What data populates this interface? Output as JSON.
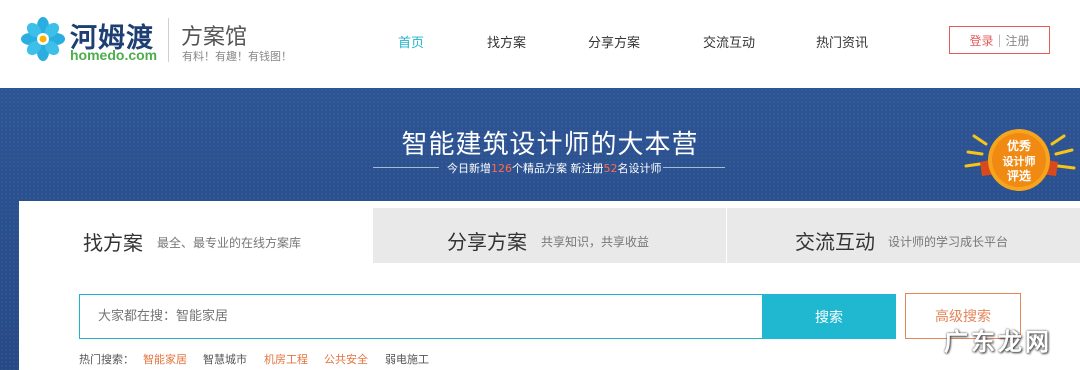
{
  "brand": {
    "name_cn": "河姆渡",
    "name_en": "homedo.com",
    "site_name": "方案馆",
    "slogan": "有料！有趣！有钱图！"
  },
  "nav": {
    "items": [
      {
        "label": "首页",
        "active": true
      },
      {
        "label": "找方案",
        "active": false
      },
      {
        "label": "分享方案",
        "active": false
      },
      {
        "label": "交流互动",
        "active": false
      },
      {
        "label": "热门资讯",
        "active": false
      }
    ]
  },
  "auth": {
    "login_label": "登录",
    "separator": "|",
    "register_label": "注册"
  },
  "banner": {
    "title": "智能建筑设计师的大本营",
    "sub_prefix": "今日新增",
    "new_plans": "126",
    "sub_middle": "个精品方案 新注册",
    "new_designers": "52",
    "sub_suffix": "名设计师",
    "badge_line1": "优秀",
    "badge_line2": "设计师",
    "badge_line3": "评选"
  },
  "tabs": [
    {
      "title": "找方案",
      "desc": "最全、最专业的在线方案库",
      "active": true
    },
    {
      "title": "分享方案",
      "desc": "共享知识，共享收益",
      "active": false
    },
    {
      "title": "交流互动",
      "desc": "设计师的学习成长平台",
      "active": false
    }
  ],
  "search": {
    "placeholder": "大家都在搜：智能家居",
    "button_label": "搜索",
    "advanced_label": "高级搜索"
  },
  "hot_search": {
    "label": "热门搜索：",
    "items": [
      {
        "label": "智能家居",
        "highlight": true
      },
      {
        "label": "智慧城市",
        "highlight": false
      },
      {
        "label": "机房工程",
        "highlight": true
      },
      {
        "label": "公共安全",
        "highlight": true
      },
      {
        "label": "弱电施工",
        "highlight": false
      }
    ]
  },
  "watermark": "广东龙网",
  "colors": {
    "accent": "#20b8d0",
    "brand_blue": "#1d3f73",
    "banner_bg": "#2a4f8e",
    "login_red": "#e25d5d",
    "highlight_orange": "#e3763f"
  }
}
